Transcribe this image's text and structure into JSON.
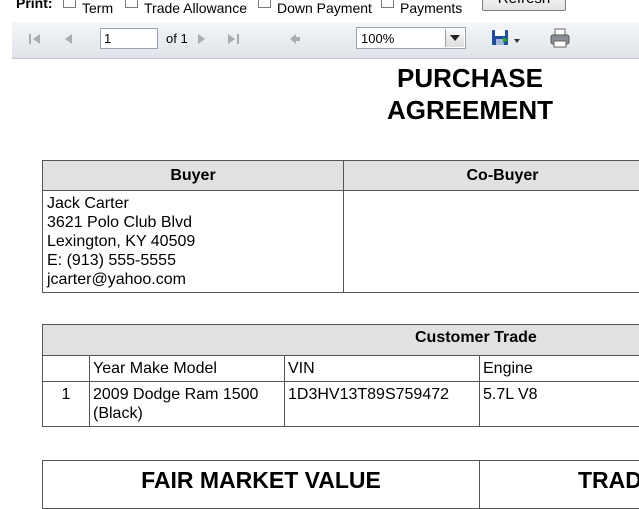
{
  "print_options": {
    "label": "Print:",
    "items": [
      {
        "label": "Term",
        "checked": false
      },
      {
        "label": "Trade Allowance",
        "checked": false
      },
      {
        "label": "Down Payment",
        "checked": false
      },
      {
        "label": "Payments",
        "checked": false
      }
    ],
    "refresh_label": "Refresh"
  },
  "toolbar": {
    "page_current": "1",
    "page_of": "of 1",
    "zoom": "100%",
    "icons": [
      "first-page-icon",
      "prev-page-icon",
      "next-page-icon",
      "last-page-icon",
      "back-icon",
      "export-icon",
      "print-icon"
    ]
  },
  "report": {
    "title_line1": "PURCHASE",
    "title_line2": "AGREEMENT",
    "buyer": {
      "header": "Buyer",
      "lines": [
        "Jack Carter",
        "3621 Polo Club Blvd",
        "Lexington, KY 40509",
        "E: (913) 555-5555",
        "jcarter@yahoo.com"
      ]
    },
    "co_buyer": {
      "header": "Co-Buyer"
    },
    "trade": {
      "header": "Customer Trade",
      "columns": [
        "",
        "Year Make Model",
        "VIN",
        "Engine"
      ],
      "rows": [
        {
          "num": "1",
          "ymm": "2009 Dodge Ram 1500 (Black)",
          "vin": "1D3HV13T89S759472",
          "engine": "5.7L V8"
        }
      ]
    },
    "fmv": {
      "left_header": "FAIR MARKET VALUE",
      "right_header": "TRAD"
    }
  },
  "colors": {
    "header_bg": "#e1e1e1",
    "toolbar_bg": "#e6e9ed",
    "export_icon": "#1f4f9c"
  }
}
